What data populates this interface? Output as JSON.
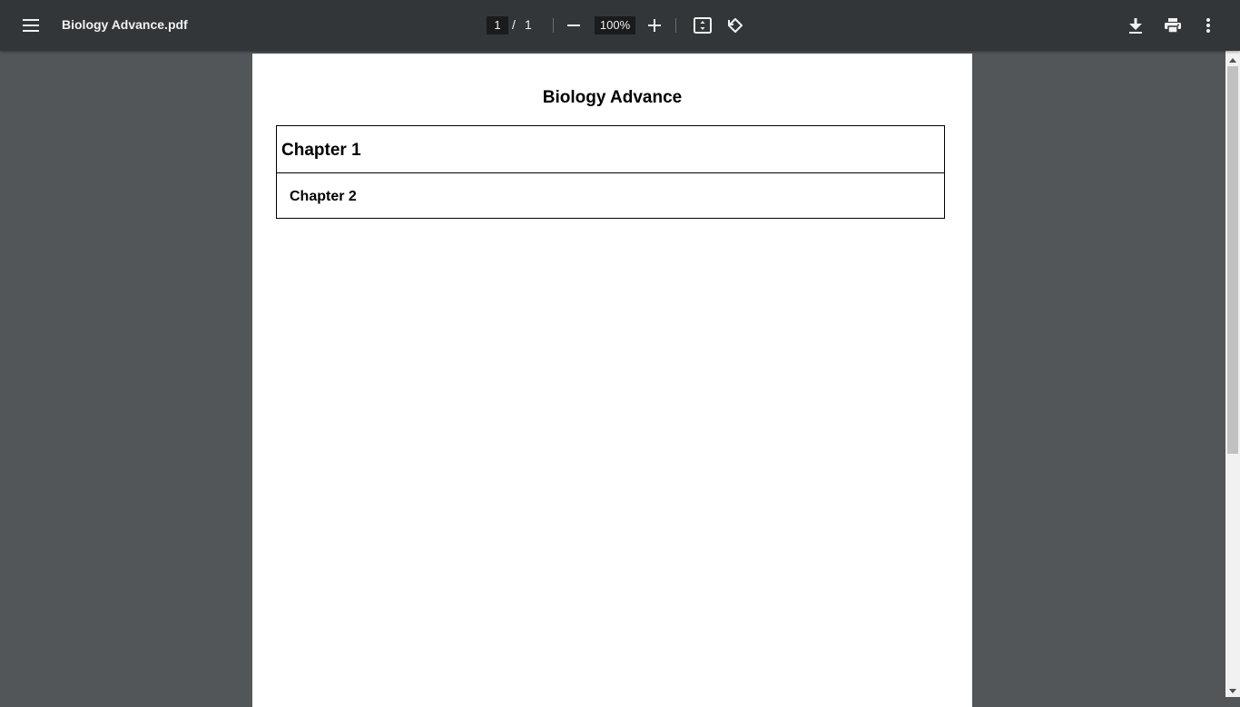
{
  "toolbar": {
    "title": "Biology Advance.pdf",
    "current_page": "1",
    "page_separator": "/",
    "total_pages": "1",
    "zoom": "100%"
  },
  "icons": {
    "menu": "menu-icon",
    "zoom_out": "minus-icon",
    "zoom_in": "plus-icon",
    "fit": "fit-to-page-icon",
    "rotate": "rotate-counterclockwise-icon",
    "download": "download-icon",
    "print": "print-icon",
    "more": "more-vertical-icon"
  },
  "document": {
    "heading": "Biology Advance",
    "toc": [
      {
        "label": "Chapter 1"
      },
      {
        "label": "Chapter 2"
      }
    ]
  },
  "colors": {
    "toolbar_bg": "#323639",
    "viewer_bg": "#525659",
    "page_bg": "#ffffff"
  }
}
